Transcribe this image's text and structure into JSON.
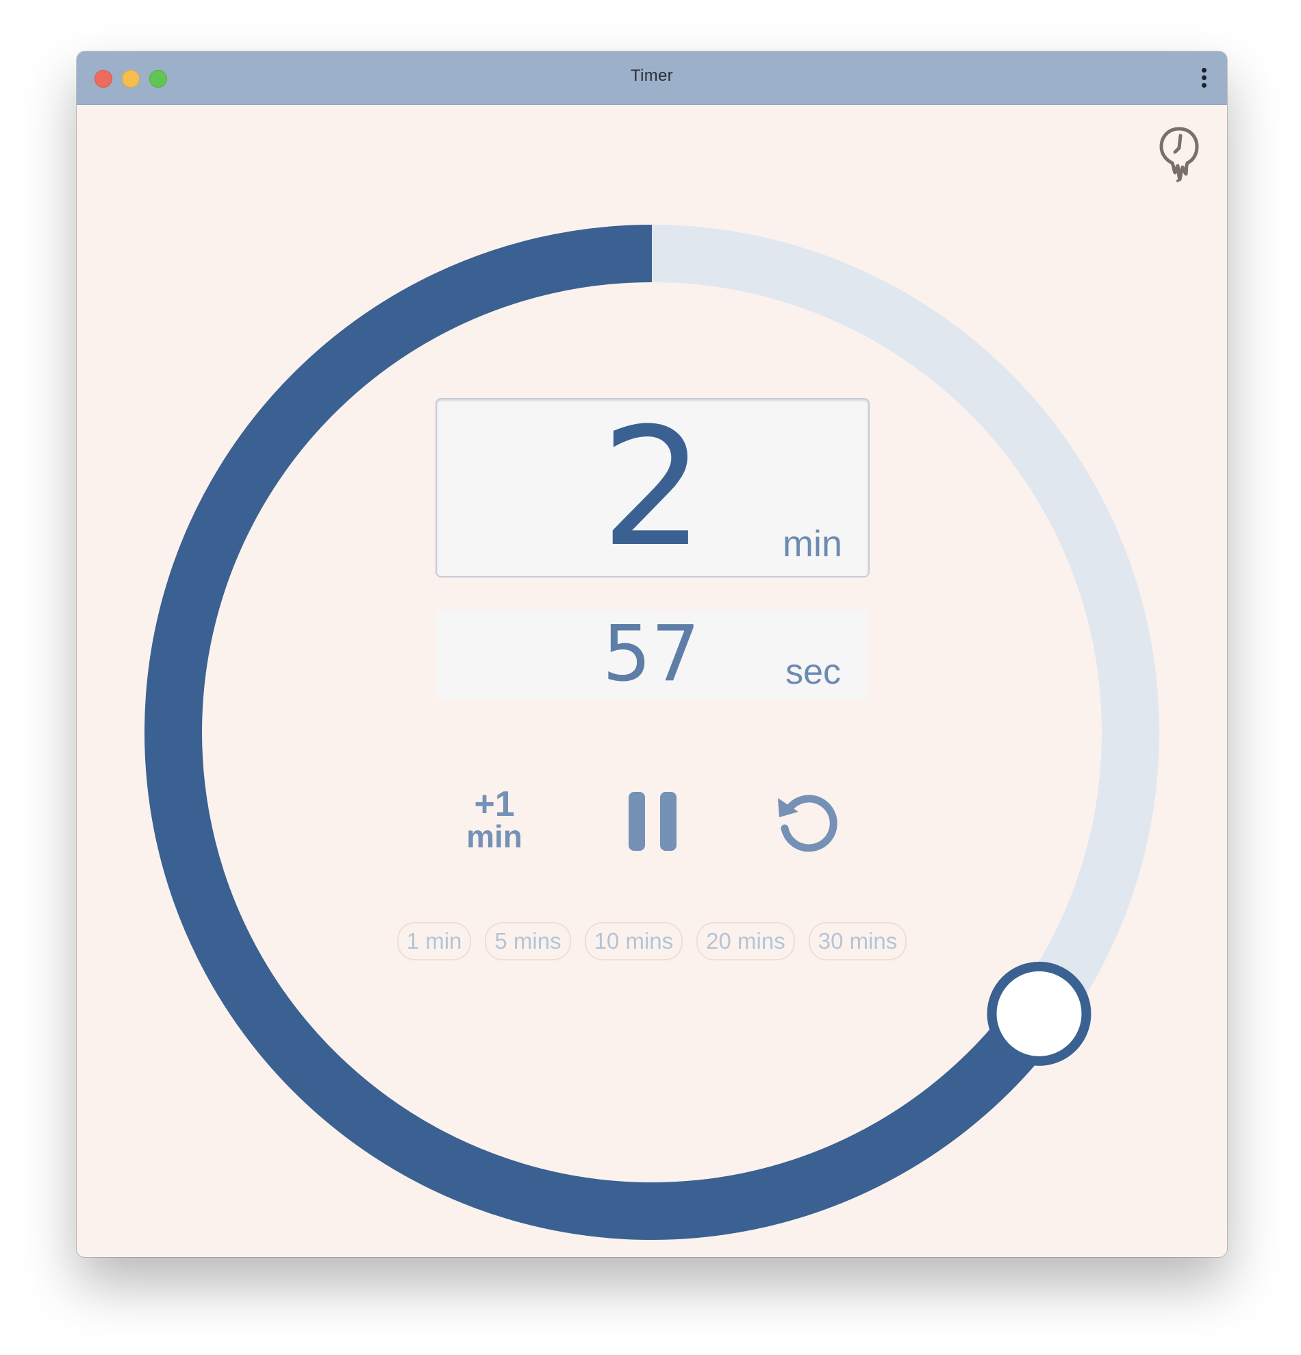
{
  "window": {
    "title": "Timer"
  },
  "timer": {
    "minutes": "2",
    "minutes_unit": "min",
    "seconds": "57",
    "seconds_unit": "sec",
    "progress_fraction": 0.65
  },
  "controls": {
    "add_minute_plus": "+1",
    "add_minute_unit": "min",
    "pause_icon": "pause-icon",
    "reset_icon": "reset-icon"
  },
  "presets": [
    "1 min",
    "5 mins",
    "10 mins",
    "20 mins",
    "30 mins"
  ],
  "icons": {
    "menu": "kebab-menu-icon",
    "melting_clock": "melting-clock-icon"
  },
  "colors": {
    "accent": "#3a6191",
    "track": "#e1e7ef",
    "background": "#fbf2ee",
    "titlebar": "#9db0c9"
  }
}
